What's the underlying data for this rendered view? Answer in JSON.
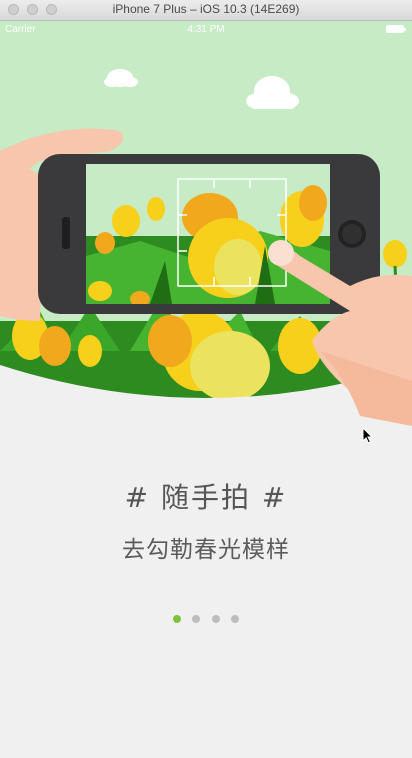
{
  "window": {
    "title": "iPhone 7 Plus – iOS 10.3 (14E269)"
  },
  "status_bar": {
    "carrier": "Carrier",
    "time": "4:31 PM"
  },
  "onboarding": {
    "title": "# 随手拍 #",
    "subtitle": "去勾勒春光模样",
    "pages": 4,
    "active_page": 1
  },
  "colors": {
    "sky": "#c7ebc4",
    "grass": "#2e8b1f",
    "tulip_yellow": "#f7d01c",
    "tulip_orange": "#f2a81d",
    "phone_body": "#3a3a3c",
    "skin": "#f7c6ad",
    "page_bg": "#f0f0f0",
    "dot_active": "#7ec23b",
    "dot_inactive": "#bdbdbd"
  }
}
